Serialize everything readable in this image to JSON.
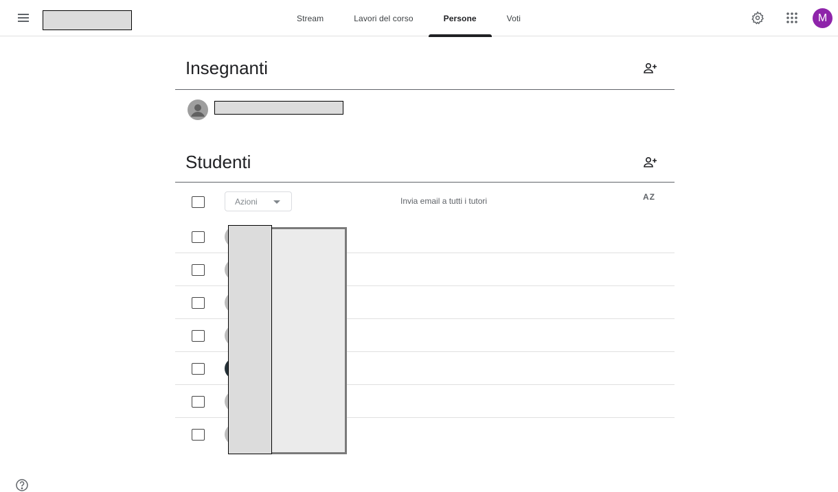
{
  "header": {
    "menu_icon": "hamburger-menu-icon",
    "tabs": [
      {
        "label": "Stream",
        "active": false
      },
      {
        "label": "Lavori del corso",
        "active": false
      },
      {
        "label": "Persone",
        "active": true
      },
      {
        "label": "Voti",
        "active": false
      }
    ],
    "settings_icon": "gear-icon",
    "apps_icon": "apps-grid-icon",
    "account_initial": "M",
    "account_color": "#8e24aa"
  },
  "teachers": {
    "title": "Insegnanti",
    "add_icon": "add-person-icon"
  },
  "students": {
    "title": "Studenti",
    "add_icon": "add-person-icon",
    "actions_label": "Azioni",
    "email_tutors_label": "Invia email a tutti i tutori",
    "sort_label": "AZ",
    "rows": 7
  },
  "footer": {
    "help_icon": "help-icon"
  }
}
